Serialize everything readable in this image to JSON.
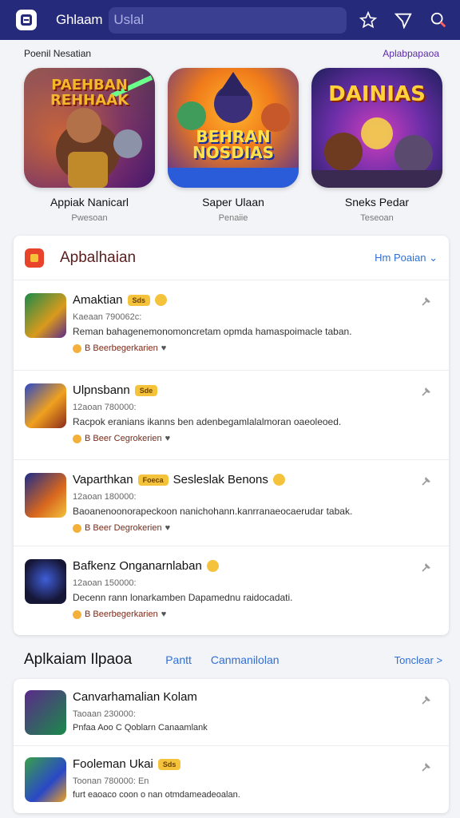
{
  "header": {
    "app_title": "Ghlaam",
    "search_value": "Uslal",
    "icons": [
      "menu-logo-icon",
      "star-icon",
      "send-icon",
      "search-icon"
    ]
  },
  "featured": {
    "heading": "Poenil Nesatian",
    "more": "Aplabpapaoa",
    "items": [
      {
        "art_title": "PAEHBAN REHHAAK",
        "name": "Appiak Nanicarl",
        "sub": "Pwesoan"
      },
      {
        "art_title": "BEHRAN NOSDIAS",
        "name": "Saper Ulaan",
        "sub": "Penaiie"
      },
      {
        "art_title": "DAINIAS",
        "name": "Sneks Pedar",
        "sub": "Teseoan"
      }
    ]
  },
  "list1": {
    "title": "Apbalhaian",
    "more": "Hm Poaian",
    "rows": [
      {
        "name": "Amaktian",
        "badge": "Sds",
        "meta": "Kaeaan 790062c:",
        "desc": "Reman bahagenemonomoncretam opmda hamaspoimacle taban.",
        "dev": "B Beerbegerkarien"
      },
      {
        "name": "Ulpnsbann",
        "badge": "Sde",
        "meta": "12aoan 780000:",
        "desc": "Racpok eranians ikanns ben adenbegamlalalmoran oaeoleoed.",
        "dev": "B Beer Cegrokerien"
      },
      {
        "name": "Vaparthkan",
        "badge": "Foeca",
        "name2": "Sesleslak Benons",
        "meta": "12aoan 180000:",
        "desc": "Baoanenoonorapeckoon nanichohann.kanrranaeocaerudar tabak.",
        "dev": "B Beer Degrokerien"
      },
      {
        "name": "Bafkenz Onganarnlaban",
        "badge": "",
        "meta": "12aoan 150000:",
        "desc": "Decenn rann lonarkamben Dapamednu raidocadati.",
        "dev": "B Beerbegerkarien"
      }
    ]
  },
  "list2": {
    "title": "Aplkaiam Ilpaoa",
    "tab1": "Pantt",
    "tab2": "Canmanilolan",
    "more": "Tonclear >",
    "rows": [
      {
        "name": "Canvarhamalian Kolam",
        "badge": "",
        "meta": "Taoaan 230000:",
        "desc": "Pnfaa Aoo C Qoblarn Canaamlank"
      },
      {
        "name": "Fooleman Ukai",
        "badge": "Sds",
        "meta": "Toonan 780000: En",
        "desc": "furt eaoaco coon o nan otmdameadeoalan."
      }
    ]
  },
  "colors": {
    "header": "#252a7a",
    "accent": "#2f6fd6",
    "badge": "#f5c33b"
  }
}
